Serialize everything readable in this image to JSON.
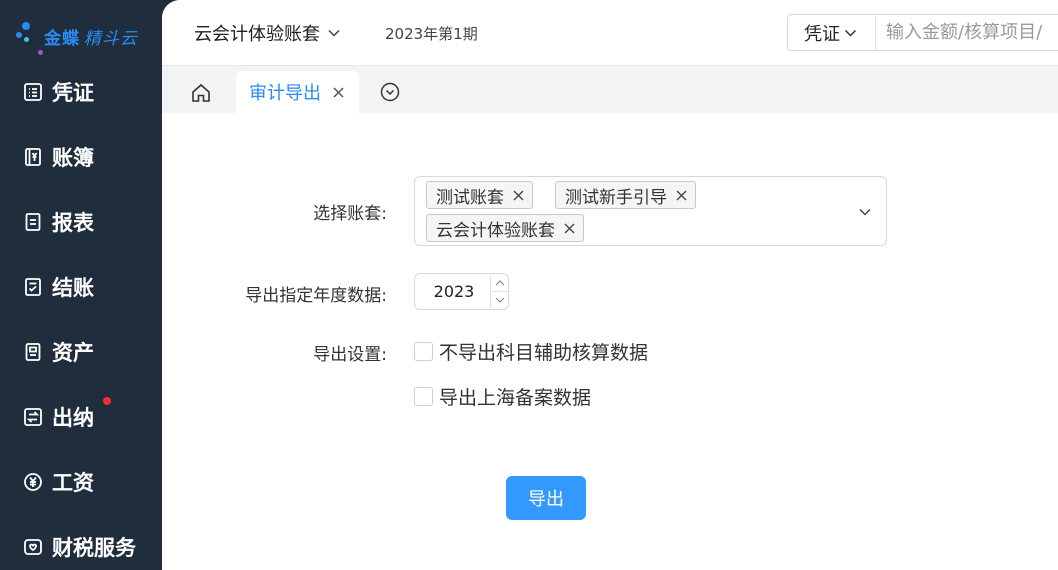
{
  "app": {
    "logo_text": "金蝶",
    "logo_sub": "精斗云"
  },
  "sidebar": {
    "items": [
      {
        "label": "凭证",
        "icon": "voucher-icon"
      },
      {
        "label": "账簿",
        "icon": "ledger-icon"
      },
      {
        "label": "报表",
        "icon": "report-icon"
      },
      {
        "label": "结账",
        "icon": "closing-icon"
      },
      {
        "label": "资产",
        "icon": "asset-icon"
      },
      {
        "label": "出纳",
        "icon": "cashier-icon",
        "badge": "red-dot"
      },
      {
        "label": "工资",
        "icon": "salary-icon"
      },
      {
        "label": "财税服务",
        "icon": "tax-service-icon"
      }
    ]
  },
  "header": {
    "account_set": "云会计体验账套",
    "period": "2023年第1期",
    "search_type": "凭证",
    "search_placeholder": "输入金额/核算项目/"
  },
  "tabs": {
    "active_label": "审计导出"
  },
  "form": {
    "account_label": "选择账套:",
    "selected_accounts": [
      "测试账套",
      "测试新手引导",
      "云会计体验账套"
    ],
    "year_label": "导出指定年度数据:",
    "year_value": "2023",
    "settings_label": "导出设置:",
    "options": [
      {
        "label": "不导出科目辅助核算数据",
        "checked": false
      },
      {
        "label": "导出上海备案数据",
        "checked": false
      }
    ],
    "export_button": "导出"
  },
  "colors": {
    "accent": "#3399ff",
    "sidebar_bg": "#1f2d3d",
    "badge": "#f23030",
    "tab_active": "#2a8bf2"
  }
}
